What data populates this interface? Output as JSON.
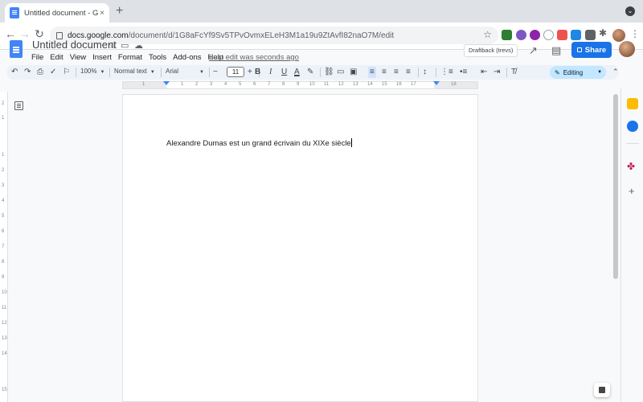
{
  "browser": {
    "tab_title": "Untitled document - Google Docs",
    "tab_close": "×",
    "new_tab": "+",
    "url_host": "docs.google.com",
    "url_path": "/document/d/1G8aFcYf9Sv5TPvOvmxELeH3M1a19u9ZtAvfI82naO7M/edit",
    "back": "←",
    "forward": "→",
    "reload": "↻",
    "bookmark_star": "☆"
  },
  "docs": {
    "title": "Untitled document",
    "menu": [
      "File",
      "Edit",
      "View",
      "Insert",
      "Format",
      "Tools",
      "Add-ons",
      "Help"
    ],
    "last_edit": "Last edit was seconds ago",
    "draftback": "Draftback (trevs)",
    "share": "Share"
  },
  "toolbar": {
    "zoom": "100%",
    "style": "Normal text",
    "font": "Arial",
    "font_size": "11",
    "minus": "−",
    "plus": "+",
    "bold": "B",
    "italic": "I",
    "underline": "U",
    "text_color": "A",
    "mode": "Editing"
  },
  "ruler": {
    "labels": [
      "1",
      "1",
      "2",
      "3",
      "4",
      "5",
      "6",
      "7",
      "8",
      "9",
      "10",
      "11",
      "12",
      "13",
      "14",
      "15",
      "16",
      "17",
      "18"
    ]
  },
  "vruler": {
    "labels": [
      "2",
      "1",
      "1",
      "2",
      "3",
      "4",
      "5",
      "6",
      "7",
      "8",
      "9",
      "10",
      "11",
      "12",
      "13",
      "14",
      "15"
    ]
  },
  "document": {
    "text": "Alexandre Dumas est un grand écrivain du XIXe siècle"
  },
  "colors": {
    "share_blue": "#1a73e8",
    "docs_blue": "#4285f4",
    "toolbar_bg": "#edf2fa",
    "editing_bg": "#c2e7ff"
  }
}
